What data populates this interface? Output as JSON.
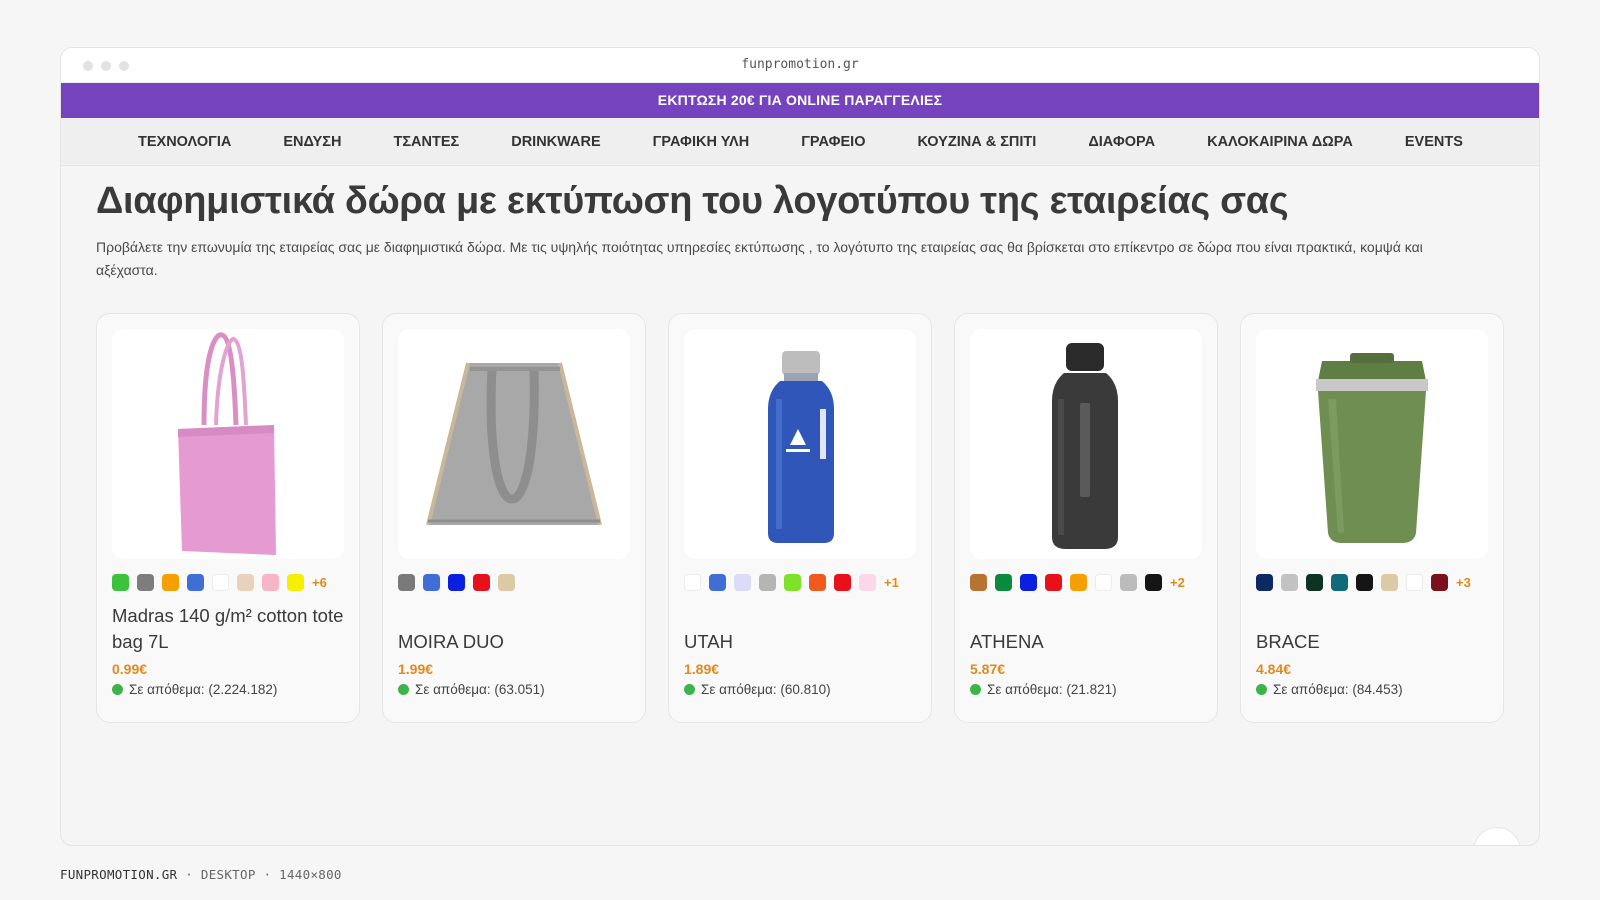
{
  "browser": {
    "url": "funpromotion.gr"
  },
  "promo_banner": "ΕΚΠΤΩΣΗ 20€ ΓΙΑ ONLINE ΠΑΡΑΓΓΕΛΙΕΣ",
  "nav": {
    "items": [
      {
        "label": "ΤΕΧΝΟΛΟΓΙΑ"
      },
      {
        "label": "ΕΝΔΥΣΗ"
      },
      {
        "label": "ΤΣΑΝΤΕΣ"
      },
      {
        "label": "DRINKWARE"
      },
      {
        "label": "ΓΡΑΦΙΚΗ ΥΛΗ"
      },
      {
        "label": "ΓΡΑΦΕΙΟ"
      },
      {
        "label": "ΚΟΥΖΙΝΑ & ΣΠΙΤΙ"
      },
      {
        "label": "ΔΙΑΦΟΡΑ"
      },
      {
        "label": "ΚΑΛΟΚΑΙΡΙΝΑ ΔΩΡΑ"
      },
      {
        "label": "EVENTS"
      }
    ]
  },
  "main": {
    "title": "Διαφημιστικά δώρα με εκτύπωση του λογοτύπου της εταιρείας σας",
    "intro": "Προβάλετε την επωνυμία της εταιρείας σας με διαφημιστικά δώρα. Με τις υψηλής ποιότητας υπηρεσίες εκτύπωσης , το λογότυπο της εταιρείας σας θα βρίσκεται στο επίκεντρο σε δώρα που είναι πρακτικά, κομψά και αξέχαστα."
  },
  "products": [
    {
      "name": "Madras 140 g/m² cotton tote bag 7L",
      "price": "0.99€",
      "stock": "Σε απόθεμα: (2.224.182)",
      "image_icon": "pink-tote-bag-icon",
      "swatches": [
        "#3cc23c",
        "#7d7d7d",
        "#f5a000",
        "#3f6fd6",
        "#ffffff",
        "#e8d2bc",
        "#f7b5c6",
        "#f6f000"
      ],
      "more": "+6"
    },
    {
      "name": "MOIRA DUO",
      "price": "1.99€",
      "stock": "Σε απόθεμα: (63.051)",
      "image_icon": "grey-drawstring-bag-icon",
      "swatches": [
        "#7a7a7a",
        "#3f6fd6",
        "#0b1fe0",
        "#e8101a",
        "#dcc9a5"
      ],
      "more": ""
    },
    {
      "name": "UTAH",
      "price": "1.89€",
      "stock": "Σε απόθεμα: (60.810)",
      "image_icon": "blue-water-bottle-icon",
      "swatches": [
        "#ffffff",
        "#3f6fd6",
        "#dcdcf6",
        "#b5b5b5",
        "#7ee22a",
        "#f05a1e",
        "#e8101a",
        "#fbd7e8"
      ],
      "more": "+1"
    },
    {
      "name": "ATHENA",
      "price": "5.87€",
      "stock": "Σε απόθεμα: (21.821)",
      "image_icon": "black-thermos-bottle-icon",
      "swatches": [
        "#b87333",
        "#0a8a3c",
        "#0b1fe0",
        "#e8101a",
        "#f5a000",
        "#ffffff",
        "#bcbcbc",
        "#151515"
      ],
      "more": "+2"
    },
    {
      "name": "BRACE",
      "price": "4.84€",
      "stock": "Σε απόθεμα: (84.453)",
      "image_icon": "green-travel-cup-icon",
      "swatches": [
        "#0b2a63",
        "#c2c2c2",
        "#0d3322",
        "#106b78",
        "#151515",
        "#dcc9a5",
        "#ffffff",
        "#7a0f1e"
      ],
      "more": "+3"
    }
  ],
  "footer": {
    "brand": "FUNPROMOTION.GR",
    "sep1": "·",
    "device": "DESKTOP",
    "sep2": "·",
    "viewport": "1440×800"
  }
}
